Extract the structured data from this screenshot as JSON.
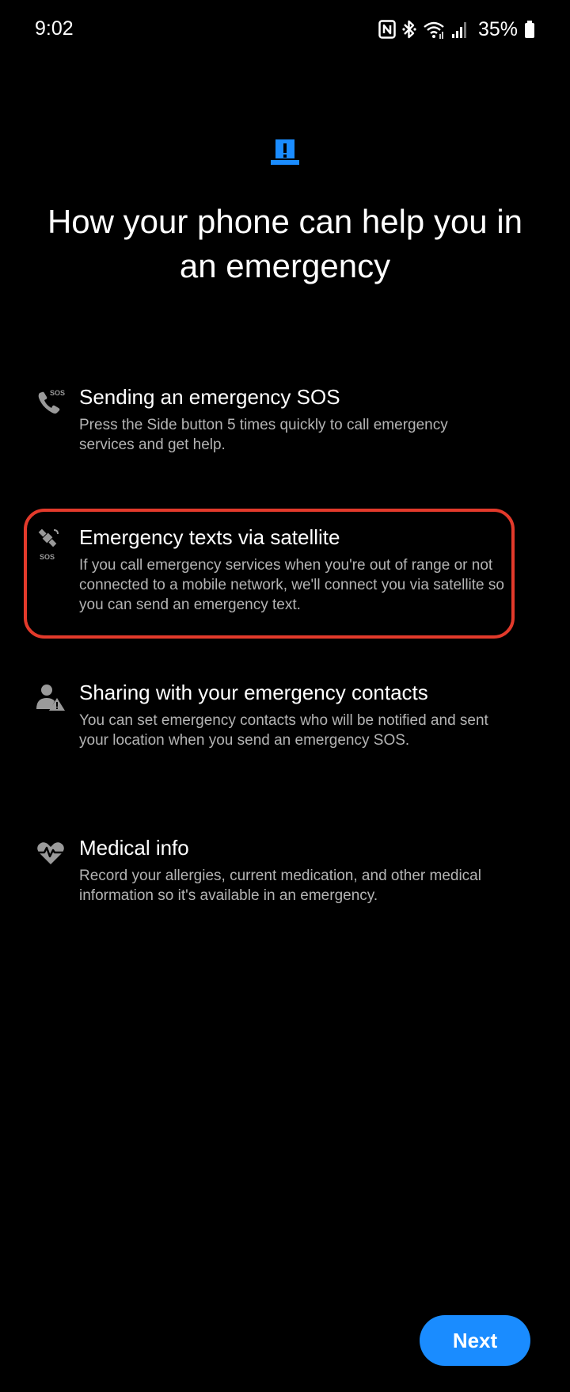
{
  "status_bar": {
    "time": "9:02",
    "battery_percent": "35%",
    "icons": [
      "nfc-icon",
      "bluetooth-icon",
      "wifi-icon",
      "signal-icon",
      "battery-icon"
    ]
  },
  "hero": {
    "icon": "alert-icon",
    "icon_color": "#1a8cff",
    "title": "How your phone can help you in an emergency"
  },
  "features": [
    {
      "icon": "phone-sos-icon",
      "title": "Sending an emergency SOS",
      "description": "Press the Side button 5 times quickly to call emergency services and get help."
    },
    {
      "icon": "satellite-sos-icon",
      "title": "Emergency texts via satellite",
      "description": "If you call emergency services when you're out of range or not connected to a mobile network, we'll connect you via satellite so you can send an emergency text.",
      "highlighted": true
    },
    {
      "icon": "contact-alert-icon",
      "title": "Sharing with your emergency contacts",
      "description": "You can set emergency contacts who will be notified and sent your location when you send an emergency SOS."
    },
    {
      "icon": "heart-pulse-icon",
      "title": "Medical info",
      "description": "Record your allergies, current medication, and other medical information so it's available in an emergency."
    }
  ],
  "icon_text": {
    "sos": "SOS"
  },
  "highlight_color": "#e33a2b",
  "next_button": {
    "label": "Next",
    "color": "#1a8cff"
  }
}
